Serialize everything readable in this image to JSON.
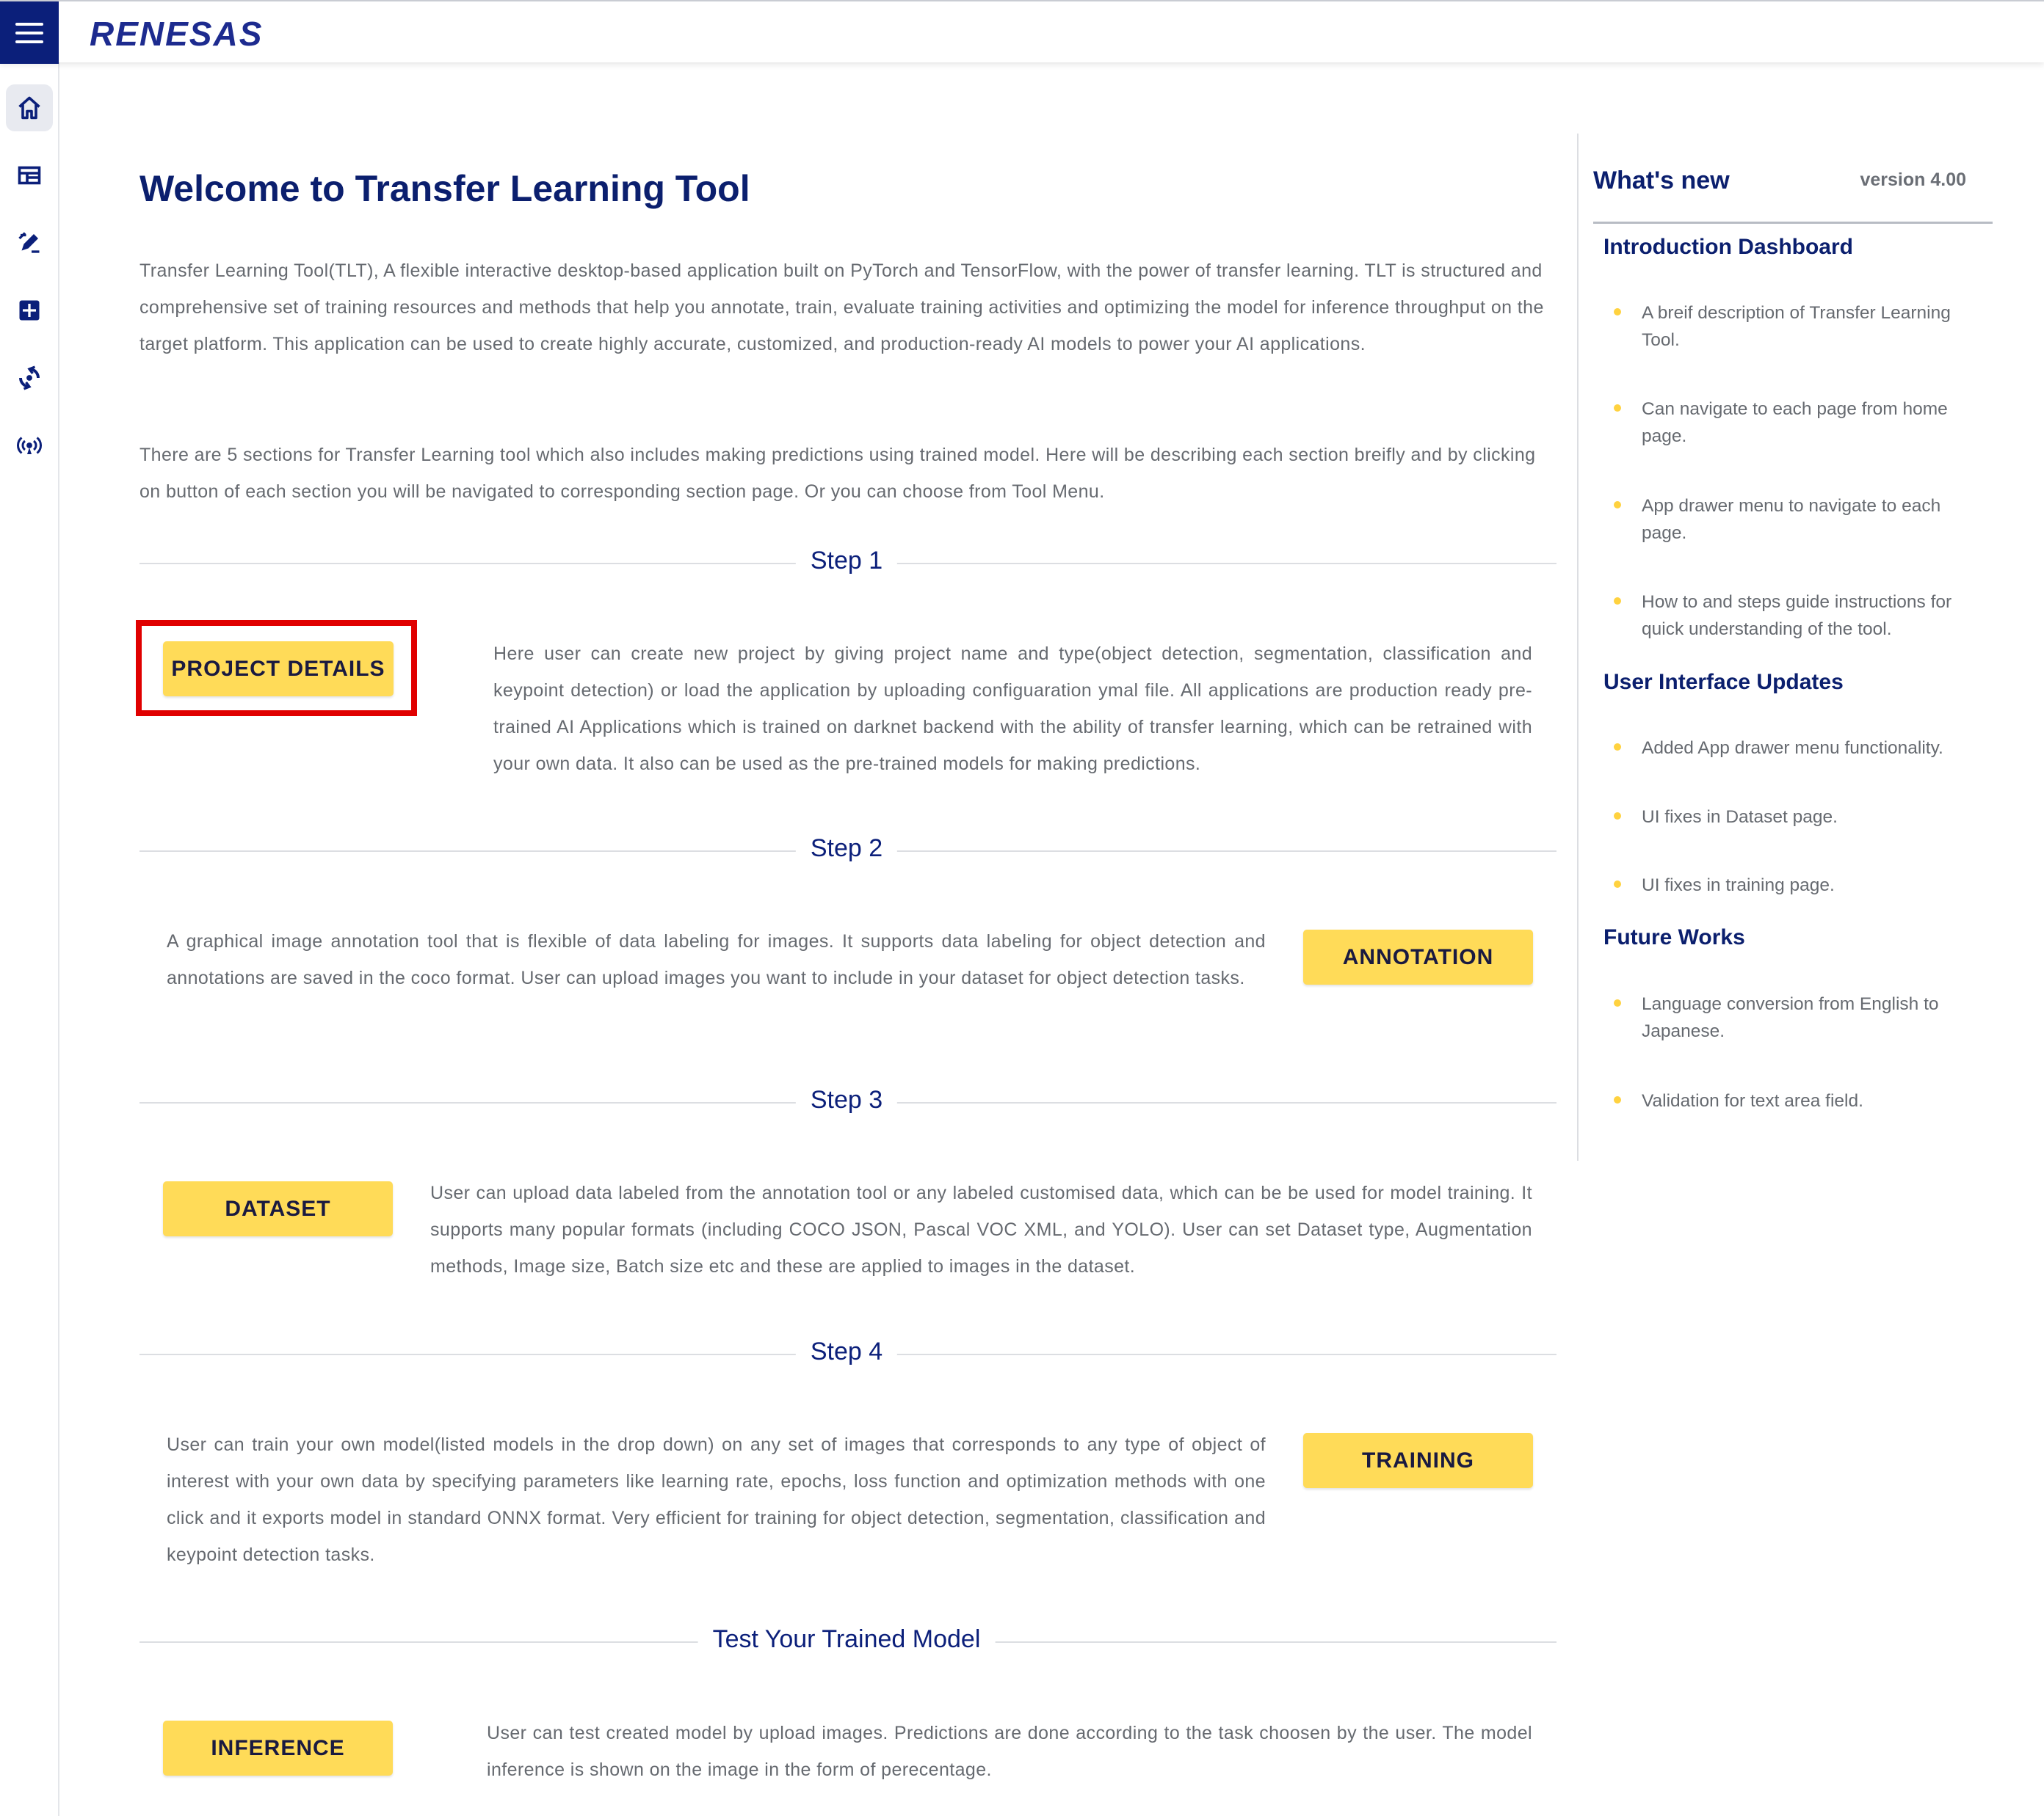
{
  "header": {
    "logo": "RENESAS"
  },
  "sidebar": {
    "icons": [
      "home-icon",
      "dashboard-icon",
      "annotation-edit-icon",
      "dataset-grid-icon",
      "training-icon",
      "inference-broadcast-icon"
    ]
  },
  "main": {
    "title": "Welcome to Transfer Learning Tool",
    "intro_p1": "Transfer Learning Tool(TLT), A flexible interactive desktop-based application built on PyTorch and TensorFlow, with the power of transfer learning. TLT is structured and comprehensive set of training resources and methods that help you annotate, train, evaluate training activities and optimizing the model for inference throughput on the target platform. This application can be used to create highly accurate, customized, and production-ready AI models to power your AI applications.",
    "intro_p2": "There are 5 sections for Transfer Learning tool which also includes making predictions using trained model. Here will be describing each section breifly and by clicking on button of each section you will be navigated to corresponding section page. Or you can choose from Tool Menu.",
    "steps": [
      {
        "label": "Step 1",
        "button": "PROJECT DETAILS",
        "description": "Here user can create new project by giving project name and type(object detection, segmentation, classification and keypoint detection) or load the application by uploading configuaration ymal file. All applications are production ready pre-trained AI Applications which is trained on darknet backend with the ability of transfer learning, which can be retrained with your own data. It also can be used as the pre-trained models for making predictions."
      },
      {
        "label": "Step 2",
        "button": "ANNOTATION",
        "description": "A graphical image annotation tool that is flexible of data labeling for images. It supports data labeling for object detection and annotations are saved in the coco format. User can upload images you want to include in your dataset for object detection tasks."
      },
      {
        "label": "Step 3",
        "button": "DATASET",
        "description": "User can upload data labeled from the annotation tool or any labeled customised data, which can be be used for model training. It supports many popular formats (including COCO JSON, Pascal VOC XML, and YOLO). User can set Dataset type, Augmentation methods, Image size, Batch size etc and these are applied to images in the dataset."
      },
      {
        "label": "Step 4",
        "button": "TRAINING",
        "description": "User can train your own model(listed models in the drop down) on any set of images that corresponds to any type of object of interest with your own data by specifying parameters like learning rate, epochs, loss function and optimization methods with one click and it exports model in standard ONNX format. Very efficient for training for object detection, segmentation, classification and keypoint detection tasks."
      },
      {
        "label": "Test Your Trained Model",
        "button": "INFERENCE",
        "description": "User can test created model by upload images. Predictions are done according to the task choosen by the user. The model inference is shown on the image in the form of perecentage."
      }
    ]
  },
  "whats_new": {
    "title": "What's new",
    "version": "version 4.00",
    "sections": [
      {
        "title": "Introduction Dashboard",
        "items": [
          "A breif description of Transfer Learning Tool.",
          "Can navigate to each page from home page.",
          "App drawer menu to navigate to each page.",
          "How to and steps guide instructions for quick understanding of the tool."
        ]
      },
      {
        "title": "User Interface Updates",
        "items": [
          "Added App drawer menu functionality.",
          "UI fixes in Dataset page.",
          "UI fixes in training page."
        ]
      },
      {
        "title": "Future Works",
        "items": [
          "Language conversion from English to Japanese.",
          "Validation for text area field."
        ]
      }
    ]
  },
  "colors": {
    "brand_navy": "#0b1f7a",
    "button_yellow": "#ffdb58",
    "highlight_red": "#e00000",
    "bullet_yellow": "#ffd23f"
  }
}
